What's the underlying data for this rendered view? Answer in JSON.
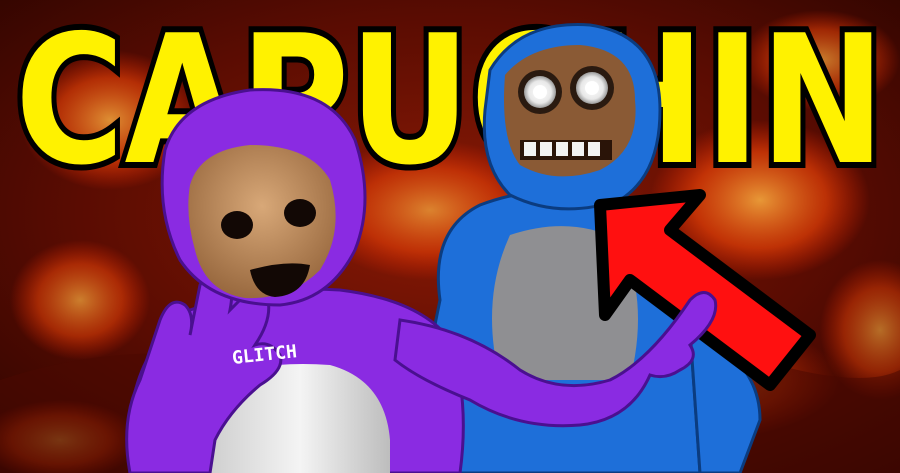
{
  "thumbnail": {
    "title": "CAPUCHIN",
    "shirt_label": "GLITCH"
  },
  "colors": {
    "title_fill": "#FFF200",
    "title_outline": "#000000",
    "purple_monkey": "#8A2BE2",
    "blue_monkey": "#1E6FD9",
    "arrow": "#FF1010",
    "lava_dark": "#3a0800",
    "lava_bright": "#ff5a10"
  },
  "icons": {
    "arrow": "red-arrow-icon"
  }
}
